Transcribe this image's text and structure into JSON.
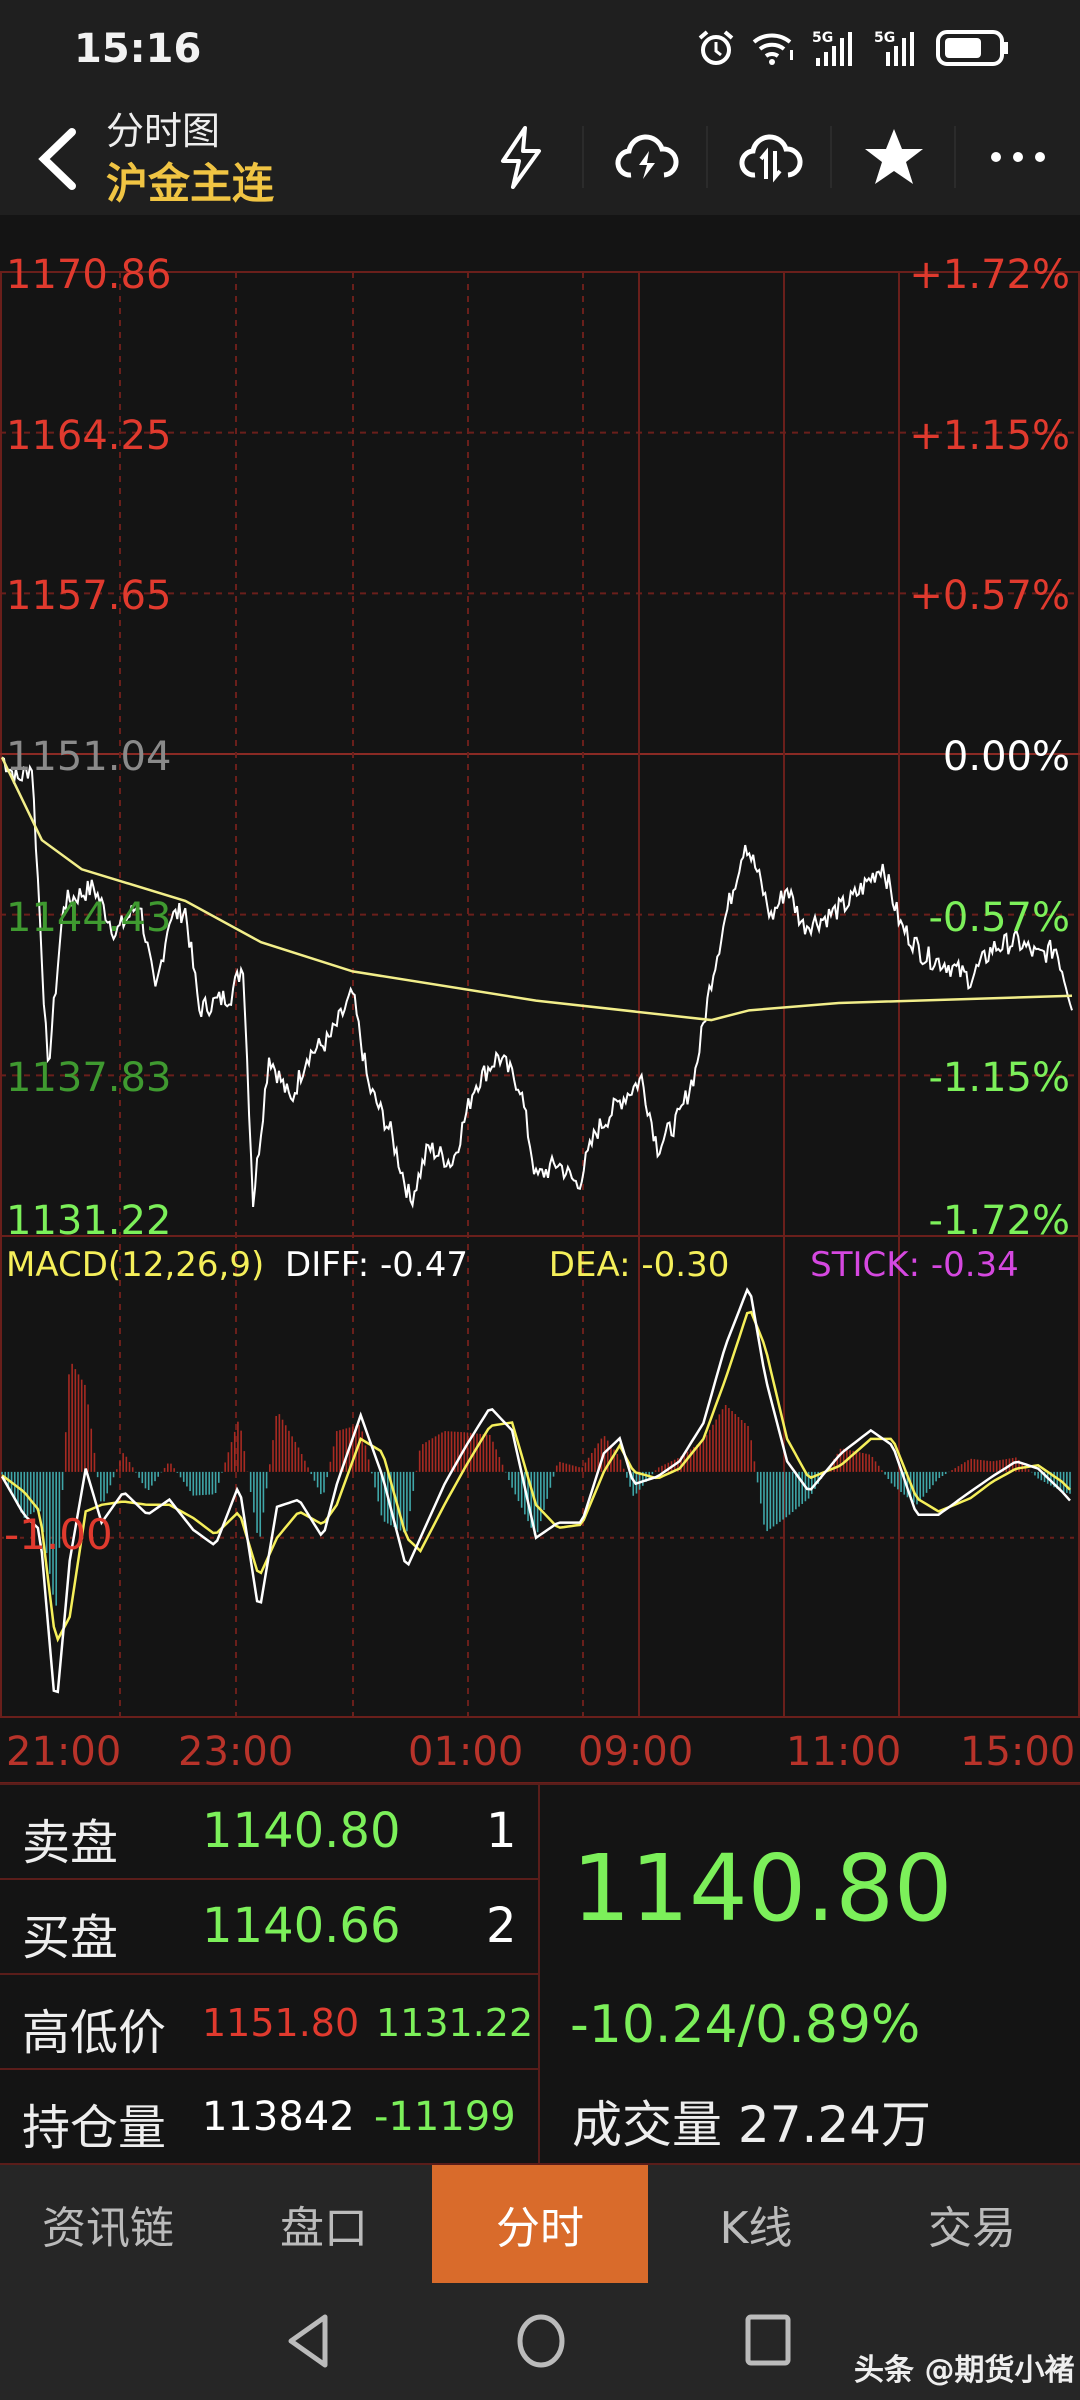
{
  "status_bar": {
    "time": "15:16",
    "icons": [
      "alarm-icon",
      "wifi-icon",
      "signal-5g-icon",
      "signal-5g-icon",
      "battery-icon"
    ]
  },
  "header": {
    "title": "分时图",
    "instrument": "沪金主连",
    "actions": [
      "flash-icon",
      "cloud-flash-icon",
      "cloud-sync-icon",
      "star-icon",
      "more-icon"
    ]
  },
  "price_axis": {
    "left": [
      {
        "label": "1170.86",
        "color": "#e03a2e"
      },
      {
        "label": "1164.25",
        "color": "#e03a2e"
      },
      {
        "label": "1157.65",
        "color": "#e03a2e"
      },
      {
        "label": "1151.04",
        "color": "#8a8a8a"
      },
      {
        "label": "1144.43",
        "color": "#3f9a30"
      },
      {
        "label": "1137.83",
        "color": "#3f9a30"
      },
      {
        "label": "1131.22",
        "color": "#7cf05a"
      }
    ],
    "right": [
      {
        "label": "+1.72%",
        "color": "#e03a2e"
      },
      {
        "label": "+1.15%",
        "color": "#e03a2e"
      },
      {
        "label": "+0.57%",
        "color": "#e03a2e"
      },
      {
        "label": "0.00%",
        "color": "#ffffff"
      },
      {
        "label": "-0.57%",
        "color": "#7cf05a"
      },
      {
        "label": "-1.15%",
        "color": "#7cf05a"
      },
      {
        "label": "-1.72%",
        "color": "#7cf05a"
      }
    ]
  },
  "macd": {
    "title": "MACD(12,26,9)",
    "diff": "DIFF: -0.47",
    "dea": "DEA: -0.30",
    "stick": "STICK: -0.34",
    "ref_label": "-1.00"
  },
  "time_axis": [
    "21:00",
    "23:00",
    "01:00",
    "09:00",
    "11:00",
    "15:00"
  ],
  "chart_data": {
    "type": "line",
    "title": "分时图 沪金主连",
    "ylim": [
      1131.22,
      1170.86
    ],
    "base_price": 1151.04,
    "x_unit": "trading minutes since 21:00 (0-540)",
    "xlim": [
      0,
      540
    ],
    "price": [
      [
        0,
        1150.91
      ],
      [
        8,
        1149.97
      ],
      [
        15,
        1150.59
      ],
      [
        23,
        1138.01
      ],
      [
        31,
        1144.93
      ],
      [
        46,
        1145.56
      ],
      [
        57,
        1143.67
      ],
      [
        69,
        1144.93
      ],
      [
        77,
        1141.16
      ],
      [
        84,
        1144.3
      ],
      [
        92,
        1144.62
      ],
      [
        99,
        1140.53
      ],
      [
        115,
        1141.16
      ],
      [
        121,
        1142.41
      ],
      [
        126,
        1132.66
      ],
      [
        134,
        1138.64
      ],
      [
        145,
        1136.75
      ],
      [
        153,
        1138.64
      ],
      [
        164,
        1139.27
      ],
      [
        176,
        1141.16
      ],
      [
        184,
        1137.38
      ],
      [
        195,
        1135.49
      ],
      [
        205,
        1132.66
      ],
      [
        214,
        1134.86
      ],
      [
        226,
        1134.23
      ],
      [
        237,
        1137.38
      ],
      [
        249,
        1138.64
      ],
      [
        260,
        1137.38
      ],
      [
        268,
        1133.6
      ],
      [
        279,
        1134.23
      ],
      [
        289,
        1133.29
      ],
      [
        298,
        1135.49
      ],
      [
        310,
        1136.75
      ],
      [
        321,
        1137.69
      ],
      [
        329,
        1134.86
      ],
      [
        340,
        1136.12
      ],
      [
        348,
        1138.01
      ],
      [
        356,
        1141.79
      ],
      [
        363,
        1144.3
      ],
      [
        373,
        1147.45
      ],
      [
        379,
        1146.19
      ],
      [
        386,
        1144.3
      ],
      [
        394,
        1145.56
      ],
      [
        402,
        1143.99
      ],
      [
        413,
        1144.3
      ],
      [
        425,
        1144.93
      ],
      [
        432,
        1145.56
      ],
      [
        442,
        1146.5
      ],
      [
        451,
        1143.99
      ],
      [
        463,
        1142.73
      ],
      [
        474,
        1142.41
      ],
      [
        486,
        1141.79
      ],
      [
        497,
        1143.05
      ],
      [
        509,
        1143.36
      ],
      [
        520,
        1142.73
      ],
      [
        529,
        1143.05
      ],
      [
        537,
        1140.8
      ]
    ],
    "avg_price": [
      [
        0,
        1150.9
      ],
      [
        20,
        1147.5
      ],
      [
        40,
        1146.3
      ],
      [
        92,
        1145.0
      ],
      [
        130,
        1143.3
      ],
      [
        176,
        1142.1
      ],
      [
        268,
        1140.9
      ],
      [
        356,
        1140.1
      ],
      [
        375,
        1140.5
      ],
      [
        420,
        1140.8
      ],
      [
        537,
        1141.1
      ]
    ],
    "macd_ylim": [
      -3.72,
      3.58
    ],
    "macd_x": [
      0,
      11,
      19,
      27,
      34,
      42,
      50,
      61,
      73,
      84,
      96,
      107,
      119,
      129,
      138,
      149,
      161,
      168,
      180,
      191,
      203,
      210,
      222,
      233,
      245,
      256,
      268,
      279,
      291,
      302,
      310,
      317,
      329,
      340,
      352,
      363,
      375,
      383,
      394,
      405,
      421,
      436,
      447,
      459,
      470,
      486,
      497,
      509,
      520,
      532,
      537
    ],
    "diff": [
      -0.07,
      -0.65,
      -0.88,
      -3.67,
      -1.35,
      0.05,
      -0.77,
      -0.3,
      -0.65,
      -0.42,
      -0.88,
      -1.12,
      -0.19,
      -2.16,
      -0.53,
      -0.42,
      -1.0,
      -0.19,
      0.86,
      -0.07,
      -1.47,
      -1.0,
      -0.19,
      0.4,
      0.98,
      0.63,
      -1.0,
      -0.77,
      -0.77,
      0.28,
      0.51,
      -0.19,
      -0.07,
      0.16,
      0.74,
      1.91,
      2.84,
      1.44,
      0.16,
      -0.3,
      0.28,
      0.63,
      0.4,
      -0.65,
      -0.65,
      -0.3,
      -0.07,
      0.16,
      0.05,
      -0.3,
      -0.47
    ],
    "dea": [
      -0.05,
      -0.3,
      -0.6,
      -2.6,
      -2.2,
      -0.6,
      -0.5,
      -0.45,
      -0.5,
      -0.5,
      -0.7,
      -0.95,
      -0.6,
      -1.6,
      -1.0,
      -0.6,
      -0.8,
      -0.5,
      0.5,
      0.3,
      -1.0,
      -1.2,
      -0.5,
      0.1,
      0.7,
      0.75,
      -0.5,
      -0.85,
      -0.8,
      0.0,
      0.4,
      0.0,
      -0.1,
      0.05,
      0.5,
      1.4,
      2.5,
      1.9,
      0.5,
      -0.1,
      0.1,
      0.5,
      0.5,
      -0.4,
      -0.6,
      -0.4,
      -0.15,
      0.05,
      0.1,
      -0.15,
      -0.3
    ],
    "colors": {
      "price": "#ffffff",
      "avg": "#f2ee8a",
      "diff": "#ffffff",
      "dea": "#f5ef5a",
      "stick_up": "#a82a22",
      "stick_down": "#3fa6a8",
      "grid": "#6a1f1b"
    }
  },
  "quote": {
    "ask": {
      "label": "卖盘",
      "price": "1140.80",
      "qty": "1"
    },
    "bid": {
      "label": "买盘",
      "price": "1140.66",
      "qty": "2"
    },
    "hilo": {
      "label": "高低价",
      "high": "1151.80",
      "low": "1131.22"
    },
    "oi": {
      "label": "持仓量",
      "value": "113842",
      "change": "-11199"
    },
    "last": "1140.80",
    "change": "-10.24/0.89%",
    "volume_label": "成交量",
    "volume": "27.24万"
  },
  "tabs": [
    "资讯链",
    "盘口",
    "分时",
    "K线",
    "交易"
  ],
  "active_tab": 2,
  "watermark": "头条 @期货小褚"
}
